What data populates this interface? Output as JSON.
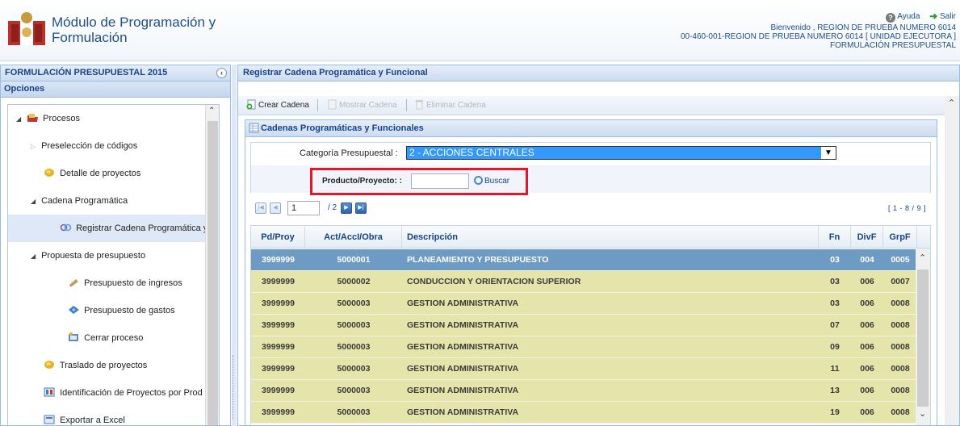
{
  "header": {
    "title_line1": "Módulo de Programación y",
    "title_line2": "Formulación",
    "help_label": "Ayuda",
    "exit_label": "Salir",
    "welcome": "Bienvenido , REGION DE PRUEBA NUMERO 6014",
    "unit": "00-460-001-REGION DE PRUEBA NUMERO 6014 [ UNIDAD EJECUTORA ]",
    "module": "FORMULACIÓN PRESUPUESTAL"
  },
  "sidebar": {
    "title": "FORMULACIÓN PRESUPUESTAL 2015",
    "options_title": "Opciones",
    "items": [
      {
        "label": "Procesos"
      },
      {
        "label": "Preselección de códigos"
      },
      {
        "label": "Detalle de proyectos"
      },
      {
        "label": "Cadena Programática"
      },
      {
        "label": "Registrar Cadena Programática y"
      },
      {
        "label": "Propuesta de presupuesto"
      },
      {
        "label": "Presupuesto de ingresos"
      },
      {
        "label": "Presupuesto de gastos"
      },
      {
        "label": "Cerrar proceso"
      },
      {
        "label": "Traslado de proyectos"
      },
      {
        "label": "Identificación de Proyectos por Prod"
      },
      {
        "label": "Exportar a Excel"
      }
    ]
  },
  "main": {
    "title": "Registrar Cadena Programática y Funcional",
    "toolbar": {
      "create": "Crear Cadena",
      "show": "Mostrar Cadena",
      "delete": "Eliminar Cadena"
    },
    "panel_title": "Cadenas Programáticas y Funcionales",
    "form": {
      "category_label": "Categoría Presupuestal :",
      "category_value": "2 - ACCIONES CENTRALES",
      "product_label": "Producto/Proyecto: :",
      "product_value": "",
      "search_label": "Buscar"
    },
    "pager": {
      "page": "1",
      "of": "/ 2",
      "range": "[ 1 - 8 / 9 ]"
    },
    "grid": {
      "headers": {
        "pd": "Pd/Proy",
        "act": "Act/AccI/Obra",
        "desc": "Descripción",
        "fn": "Fn",
        "div": "DivF",
        "grp": "GrpF"
      },
      "rows": [
        {
          "pd": "3999999",
          "act": "5000001",
          "desc": "PLANEAMIENTO Y PRESUPUESTO",
          "fn": "03",
          "div": "004",
          "grp": "0005"
        },
        {
          "pd": "3999999",
          "act": "5000002",
          "desc": "CONDUCCION Y ORIENTACION SUPERIOR",
          "fn": "03",
          "div": "006",
          "grp": "0007"
        },
        {
          "pd": "3999999",
          "act": "5000003",
          "desc": "GESTION ADMINISTRATIVA",
          "fn": "03",
          "div": "006",
          "grp": "0008"
        },
        {
          "pd": "3999999",
          "act": "5000003",
          "desc": "GESTION ADMINISTRATIVA",
          "fn": "07",
          "div": "006",
          "grp": "0008"
        },
        {
          "pd": "3999999",
          "act": "5000003",
          "desc": "GESTION ADMINISTRATIVA",
          "fn": "09",
          "div": "006",
          "grp": "0008"
        },
        {
          "pd": "3999999",
          "act": "5000003",
          "desc": "GESTION ADMINISTRATIVA",
          "fn": "11",
          "div": "006",
          "grp": "0008"
        },
        {
          "pd": "3999999",
          "act": "5000003",
          "desc": "GESTION ADMINISTRATIVA",
          "fn": "13",
          "div": "006",
          "grp": "0008"
        },
        {
          "pd": "3999999",
          "act": "5000003",
          "desc": "GESTION ADMINISTRATIVA",
          "fn": "19",
          "div": "006",
          "grp": "0008"
        }
      ]
    }
  },
  "colors": {
    "accent": "#15428b",
    "selected_row": "#6d9bc4",
    "row_bg": "#e5e4aa",
    "highlight_border": "#e0192a"
  }
}
